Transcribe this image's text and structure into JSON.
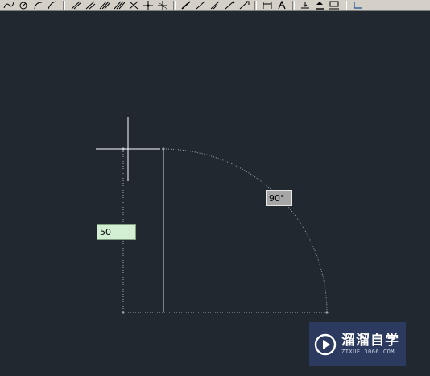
{
  "toolbar": {
    "draw_tools": [
      "arc-3point-icon",
      "circle-icon",
      "arc-icon",
      "spline-icon"
    ],
    "hatch_tools": [
      "line-icon",
      "polyline-icon",
      "hatch-icon",
      "gradient-icon",
      "trim-icon",
      "move-icon",
      "explode-icon"
    ],
    "dim_tools": [
      "dim-linear-icon",
      "dim-aligned-icon",
      "dim-angular-icon",
      "dim-radius-icon",
      "dim-diameter-icon"
    ],
    "text_tools": [
      "text-style-icon",
      "multiline-text-icon"
    ],
    "layer_tools": [
      "layer-align-icon",
      "layer-bottom-icon",
      "layer-properties-icon"
    ]
  },
  "drawing": {
    "length_input": "50",
    "angle_tooltip": "90°"
  },
  "watermark": {
    "title": "溜溜自学",
    "url": "ZIXUE.3066.COM"
  },
  "colors": {
    "background": "#212830",
    "input_bg": "#d3efd3",
    "tooltip_bg": "#a6a6a6",
    "crosshair": "#ffffff",
    "dotted_line": "#a9adb2",
    "watermark_bg": "#2b3a5e"
  }
}
